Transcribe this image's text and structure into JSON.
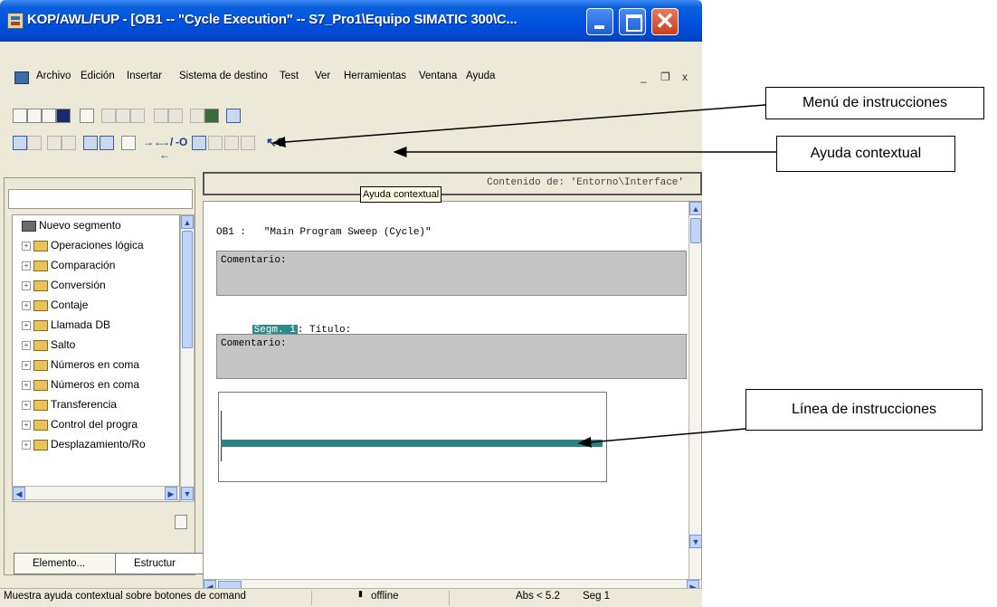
{
  "window": {
    "title": "KOP/AWL/FUP  - [OB1 -- \"Cycle Execution\" -- S7_Pro1\\Equipo SIMATIC 300\\C..."
  },
  "menu": {
    "items": [
      "Archivo",
      "Edición",
      "Insertar",
      "Sistema de destino",
      "Test",
      "Ver",
      "Herramientas",
      "Ventana",
      "Ayuda"
    ],
    "mdi_controls": [
      "_",
      "❐",
      "x"
    ]
  },
  "toolbar": {
    "row2_lad": [
      "→←",
      "→/←",
      "-O"
    ],
    "help_glyph": "↖?"
  },
  "context_bar": {
    "text": "Contenido de: 'Entorno\\Interface'"
  },
  "tooltip": {
    "text": "Ayuda contextual"
  },
  "tree": {
    "items": [
      {
        "label": "Nuevo segmento",
        "type": "segment"
      },
      {
        "label": "Operaciones lógica",
        "type": "folder"
      },
      {
        "label": "Comparación",
        "type": "folder"
      },
      {
        "label": "Conversión",
        "type": "folder"
      },
      {
        "label": "Contaje",
        "type": "folder"
      },
      {
        "label": "Llamada DB",
        "type": "folder"
      },
      {
        "label": "Salto",
        "type": "folder"
      },
      {
        "label": "Números en coma",
        "type": "folder"
      },
      {
        "label": "Números en coma",
        "type": "folder"
      },
      {
        "label": "Transferencia",
        "type": "folder"
      },
      {
        "label": "Control del progra",
        "type": "folder"
      },
      {
        "label": "Desplazamiento/Ro",
        "type": "folder"
      }
    ],
    "tabs": [
      "Elemento...",
      "Estructur"
    ]
  },
  "editor": {
    "block_header": "OB1 :   \"Main Program Sweep (Cycle)\"",
    "comment1": "Comentario:",
    "segment_label": "Segm. 1",
    "segment_title": ": Título:",
    "comment2": "Comentario:"
  },
  "status": {
    "help_text": "Muestra ayuda contextual sobre botones de comand",
    "mode": "offline",
    "abs": "Abs < 5.2",
    "seg": "Seg 1"
  },
  "callouts": {
    "menu": "Menú de instrucciones",
    "help": "Ayuda contextual",
    "line": "Línea de instrucciones"
  }
}
